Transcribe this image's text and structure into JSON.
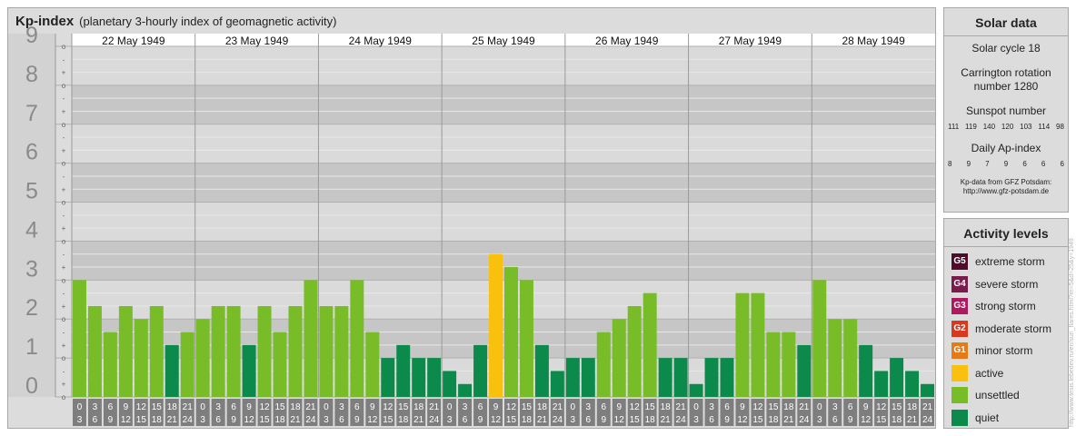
{
  "header": {
    "title": "Kp-index",
    "subtitle": "(planetary 3-hourly index of geomagnetic activity)"
  },
  "chart_data": {
    "type": "bar",
    "title": "Kp-index",
    "subtitle": "(planetary 3-hourly index of geomagnetic activity)",
    "ylim": [
      0,
      9
    ],
    "major_ticks": [
      "0",
      "1",
      "2",
      "3",
      "4",
      "5",
      "6",
      "7",
      "8",
      "9"
    ],
    "minor_ticks": [
      "o",
      "+",
      "-",
      "o",
      "+",
      "-",
      "o",
      "+",
      "-",
      "o",
      "+",
      "-",
      "o",
      "+",
      "-",
      "o",
      "+",
      "-",
      "o",
      "+",
      "-",
      "o",
      "+",
      "-",
      "o",
      "+",
      "-",
      "o"
    ],
    "days": [
      "22 May 1949",
      "23 May 1949",
      "24 May 1949",
      "25 May 1949",
      "26 May 1949",
      "27 May 1949",
      "28 May 1949"
    ],
    "interval_start": [
      "0",
      "3",
      "6",
      "9",
      "12",
      "15",
      "18",
      "21"
    ],
    "interval_end": [
      "3",
      "6",
      "9",
      "12",
      "15",
      "18",
      "21",
      "24"
    ],
    "values": [
      [
        3,
        2.333,
        1.667,
        2.333,
        2,
        2.333,
        1.333,
        1.667
      ],
      [
        2,
        2.333,
        2.333,
        1.333,
        2.333,
        1.667,
        2.333,
        3
      ],
      [
        2.333,
        2.333,
        3,
        1.667,
        1,
        1.333,
        1,
        1
      ],
      [
        0.667,
        0.333,
        1.333,
        3.667,
        3.333,
        3,
        1.333,
        0.667
      ],
      [
        1,
        1,
        1.667,
        2,
        2.333,
        2.667,
        1,
        1
      ],
      [
        0.333,
        1,
        1,
        2.667,
        2.667,
        1.667,
        1.667,
        1.333
      ],
      [
        3,
        2,
        2,
        1.333,
        0.667,
        1,
        0.667,
        0.333
      ]
    ]
  },
  "solar": {
    "header": "Solar data",
    "cycle": "Solar cycle 18",
    "carrington_line1": "Carrington rotation",
    "carrington_line2": "number 1280",
    "sunspot_label": "Sunspot number",
    "sunspot_values": [
      "111",
      "119",
      "140",
      "120",
      "103",
      "114",
      "98"
    ],
    "ap_label": "Daily Ap-index",
    "ap_values": [
      "8",
      "9",
      "7",
      "9",
      "6",
      "6",
      "6"
    ],
    "source_line1": "Kp-data from GFZ Potsdam:",
    "source_line2": "http://www.gfz-potsdam.de"
  },
  "activity": {
    "header": "Activity levels",
    "items": [
      {
        "code": "G5",
        "label": "extreme storm",
        "color": "#4d0d2a"
      },
      {
        "code": "G4",
        "label": "severe storm",
        "color": "#7a1a4d"
      },
      {
        "code": "G3",
        "label": "strong storm",
        "color": "#b0185f"
      },
      {
        "code": "G2",
        "label": "moderate storm",
        "color": "#d9381e"
      },
      {
        "code": "G1",
        "label": "minor storm",
        "color": "#e67a17"
      },
      {
        "code": "",
        "label": "active",
        "color": "#f9c10e"
      },
      {
        "code": "",
        "label": "unsettled",
        "color": "#78bc28"
      },
      {
        "code": "",
        "label": "quiet",
        "color": "#0c8a4b"
      }
    ]
  },
  "side_text": "http://www.tesis.lebedev.ru/en/sun_flares.html?m=5&d=25&y=1949"
}
